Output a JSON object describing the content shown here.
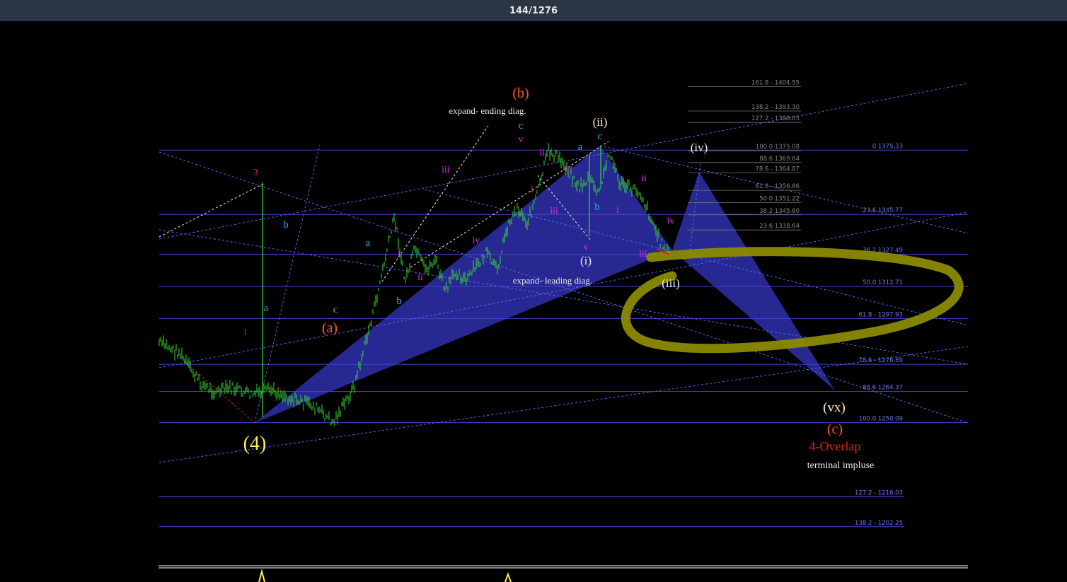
{
  "viewer": {
    "counter": "144/1276"
  },
  "chart_data": {
    "type": "line",
    "title": "",
    "xlabel": "",
    "ylabel": "",
    "ylim": [
      1195,
      1415
    ],
    "grid": false,
    "colors": {
      "price": "#33dd33",
      "level_line": "#4444cc",
      "trend_line": "#5566ee",
      "harmonic_fill": "#2a2a9a",
      "ellipse": "#8a8a00",
      "red": "#e02020",
      "orange": "#ff5522",
      "magenta": "#ee22ee",
      "cyan": "#22aaee",
      "white": "#e8e8e8",
      "yellow": "#ffee44",
      "cream": "#ffeecc"
    },
    "price_series": {
      "name": "",
      "x": [
        0,
        4,
        8,
        11,
        14,
        18,
        22,
        26,
        30,
        34,
        38,
        42,
        46,
        48,
        50,
        52,
        54,
        56,
        58,
        60,
        62,
        64,
        66,
        68,
        70,
        72,
        74,
        76,
        78,
        80,
        82,
        84,
        86,
        88,
        90,
        92,
        94,
        96,
        98,
        100
      ],
      "values": [
        1287,
        1282,
        1268,
        1264,
        1266,
        1263,
        1265,
        1261,
        1258,
        1250,
        1266,
        1302,
        1345,
        1315,
        1330,
        1320,
        1325,
        1310,
        1320,
        1315,
        1322,
        1328,
        1320,
        1340,
        1349,
        1342,
        1356,
        1375,
        1372,
        1366,
        1358,
        1362,
        1355,
        1375,
        1360,
        1358,
        1356,
        1345,
        1333,
        1327
      ]
    },
    "right_levels_a": [
      {
        "label": "161.8 -  1404.55",
        "value": 1404.55
      },
      {
        "label": "138.2 - 1393.30",
        "value": 1393.3
      },
      {
        "label": "127.2 - 1388.05",
        "value": 1388.05
      },
      {
        "label": "100.0 1375.08",
        "value": 1375.08
      },
      {
        "label": "88.6 1369.64",
        "value": 1369.64
      },
      {
        "label": "78.6 - 1364.87",
        "value": 1364.87
      },
      {
        "label": "61.8 - 1356.86",
        "value": 1356.86
      },
      {
        "label": "50.0 1351.22",
        "value": 1351.22
      },
      {
        "label": "38.2 1345.60",
        "value": 1345.6
      },
      {
        "label": "23.6 1338.64",
        "value": 1338.64
      },
      {
        "label": "0 1327.38",
        "value": 1327.38
      }
    ],
    "right_levels_b": [
      {
        "label": "0 1375.33",
        "value": 1375.33
      },
      {
        "label": "23.6 1345.77",
        "value": 1345.77
      },
      {
        "label": "38.2 1327.49",
        "value": 1327.49
      },
      {
        "label": "50.0 1312.71",
        "value": 1312.71
      },
      {
        "label": "61.8 - 1297.93",
        "value": 1297.93
      },
      {
        "label": "78.6 - 1276.89",
        "value": 1276.89
      },
      {
        "label": "88.6 1264.37",
        "value": 1264.37
      },
      {
        "label": "100.0 1250.09",
        "value": 1250.09
      },
      {
        "label": "127.2 - 1216.03",
        "value": 1216.03
      },
      {
        "label": "138.2 - 1202.25",
        "value": 1202.25
      }
    ],
    "annotations": {
      "wave_4": "(4)",
      "wave_b": "(b)",
      "wave_a": "(a)",
      "wave_c": "(c)",
      "wave_ii": "(ii)",
      "wave_i": "(i)",
      "wave_iii": "(iii)",
      "wave_iv": "(iv)",
      "wave_vx": "(vx)",
      "expand_ending": "expand- ending diag.",
      "expand_leading": "expand- leading diag.",
      "overlap": "4-Overlap",
      "terminal": "terminal impluse",
      "red_1": "1",
      "red_2": "2",
      "red_3": "3",
      "cyan_a1": "a",
      "cyan_b1": "b",
      "cyan_a2": "a",
      "cyan_c1": "c",
      "cyan_b2": "b",
      "cyan_c2": "c",
      "cyan_a3": "a",
      "cyan_c3": "c",
      "cyan_b3": "b",
      "mag_i1": "i",
      "mag_ii1": "ii",
      "mag_iii1": "iii",
      "mag_iv1": "iv",
      "mag_v1": "v",
      "mag_ii2": "ii",
      "mag_i2": "i",
      "mag_iii2": "iii",
      "mag_iv2": "iv",
      "mag_v2": "v",
      "mag_ii3": "ii",
      "mag_i3": "i",
      "mag_iii3": "iii",
      "mag_iv3": "iv"
    }
  }
}
